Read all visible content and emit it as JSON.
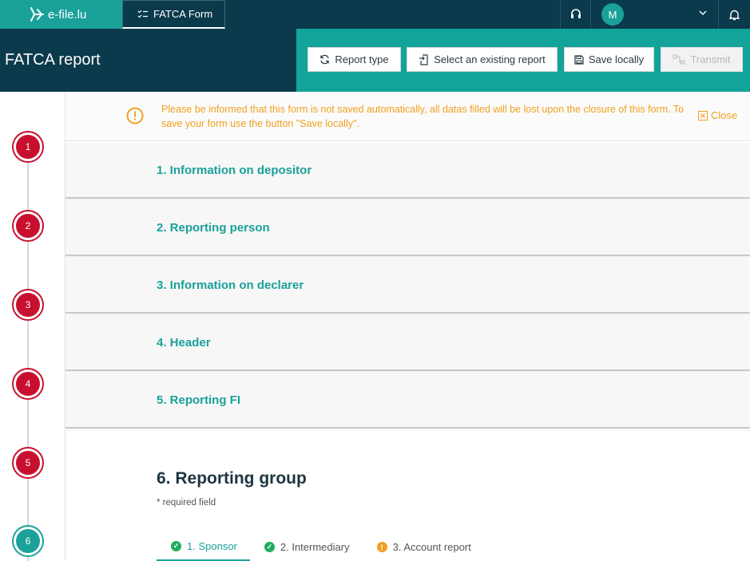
{
  "topbar": {
    "logo_text": "e-file.lu",
    "active_tab_label": "FATCA Form",
    "user_initial": "M"
  },
  "header": {
    "title": "FATCA report",
    "buttons": {
      "report_type": "Report type",
      "select_existing": "Select an existing report",
      "save_locally": "Save locally",
      "transmit": "Transmit"
    }
  },
  "notice": {
    "text": "Please be informed that this form is not saved automatically, all datas filled will be lost upon the closure of this form. To save your form use the button \"Save locally\".",
    "close_label": "Close"
  },
  "stepper": {
    "steps": [
      "1",
      "2",
      "3",
      "4",
      "5",
      "6"
    ],
    "current": "6"
  },
  "sections": [
    "1. Information on depositor",
    "2. Reporting person",
    "3. Information on declarer",
    "4. Header",
    "5. Reporting FI"
  ],
  "group": {
    "title": "6. Reporting group",
    "required_note": "* required field",
    "tabs": [
      {
        "label": "1. Sponsor",
        "status": "ok"
      },
      {
        "label": "2. Intermediary",
        "status": "ok"
      },
      {
        "label": "3. Account report",
        "status": "warning"
      }
    ]
  },
  "colors": {
    "navy": "#0b3a4c",
    "teal": "#1aa19a",
    "step_red": "#c8102e",
    "warning": "#f0a020",
    "success": "#1fae5f"
  }
}
